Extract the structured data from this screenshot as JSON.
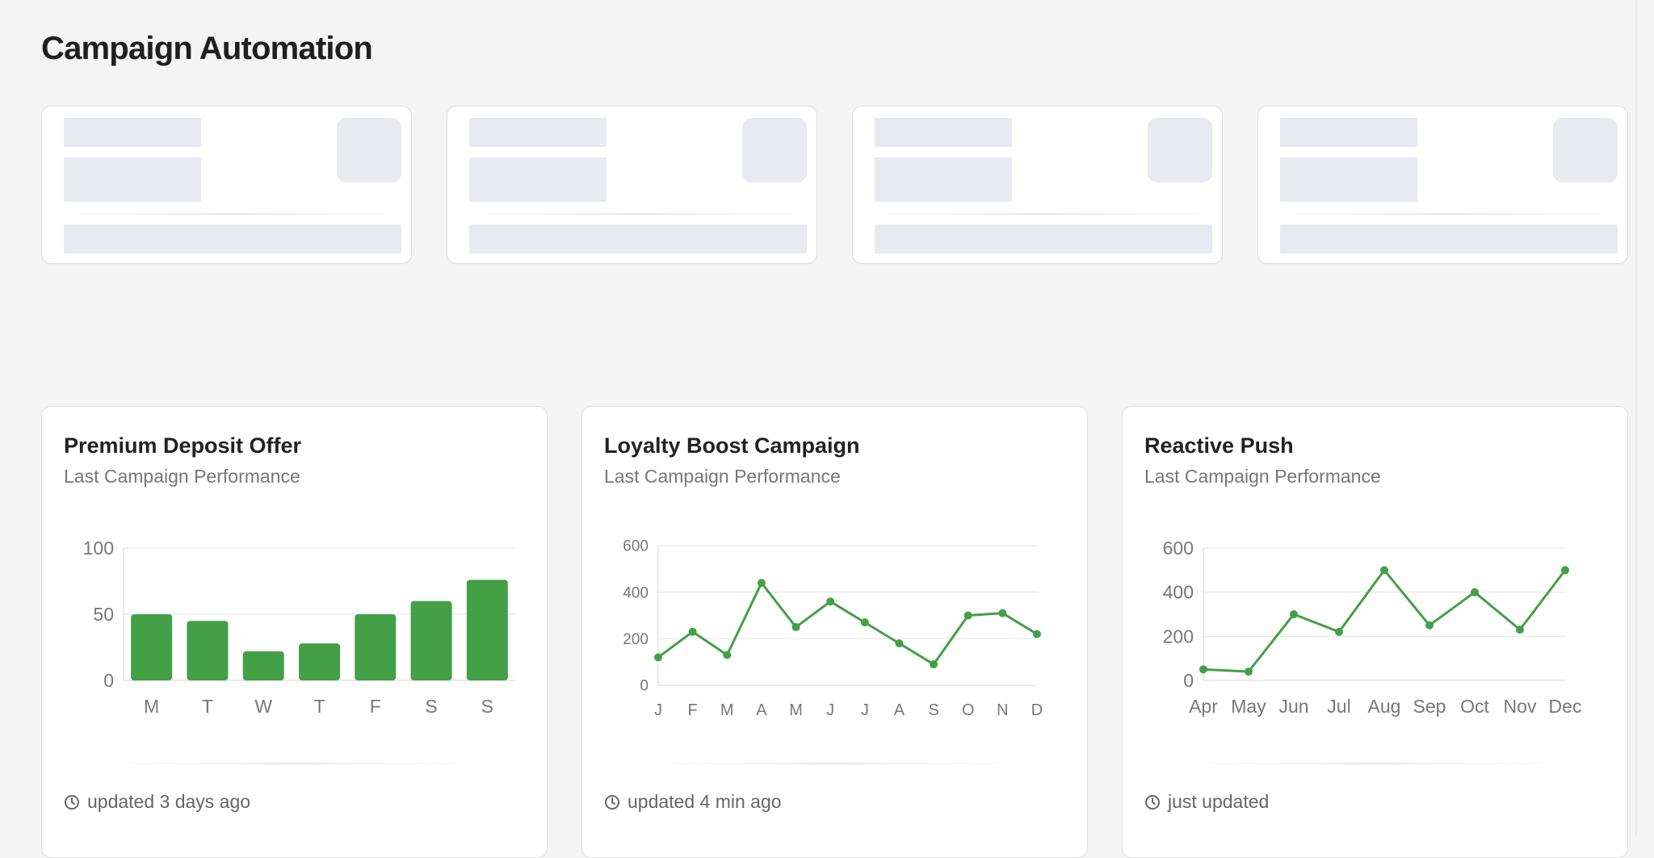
{
  "page": {
    "title": "Campaign Automation"
  },
  "accent_color": "#43a047",
  "stat_cards": [
    {
      "state": "loading"
    },
    {
      "state": "loading"
    },
    {
      "state": "loading"
    },
    {
      "state": "loading"
    }
  ],
  "campaign_cards": [
    {
      "title": "Premium Deposit Offer",
      "subtitle": "Last Campaign Performance",
      "updated": "updated 3 days ago",
      "icon": "clock-icon"
    },
    {
      "title": "Loyalty Boost Campaign",
      "subtitle": "Last Campaign Performance",
      "updated": "updated 4 min ago",
      "icon": "clock-icon"
    },
    {
      "title": "Reactive Push",
      "subtitle": "Last Campaign Performance",
      "updated": "just updated",
      "icon": "clock-icon"
    }
  ],
  "chart_data": [
    {
      "type": "bar",
      "categories": [
        "M",
        "T",
        "W",
        "T",
        "F",
        "S",
        "S"
      ],
      "values": [
        50,
        45,
        22,
        28,
        50,
        60,
        76
      ],
      "ylim": [
        0,
        100
      ],
      "yticks": [
        0,
        50,
        100
      ],
      "grid": true,
      "color": "#43a047"
    },
    {
      "type": "line",
      "categories": [
        "J",
        "F",
        "M",
        "A",
        "M",
        "J",
        "J",
        "A",
        "S",
        "O",
        "N",
        "D"
      ],
      "values": [
        120,
        230,
        130,
        440,
        250,
        360,
        270,
        180,
        90,
        300,
        310,
        220
      ],
      "ylim": [
        0,
        600
      ],
      "yticks": [
        0,
        200,
        400,
        600
      ],
      "grid": true,
      "color": "#43a047"
    },
    {
      "type": "line",
      "categories": [
        "Apr",
        "May",
        "Jun",
        "Jul",
        "Aug",
        "Sep",
        "Oct",
        "Nov",
        "Dec"
      ],
      "values": [
        50,
        40,
        300,
        220,
        500,
        250,
        400,
        230,
        500
      ],
      "ylim": [
        0,
        600
      ],
      "yticks": [
        0,
        200,
        400,
        600
      ],
      "grid": true,
      "color": "#43a047"
    }
  ]
}
